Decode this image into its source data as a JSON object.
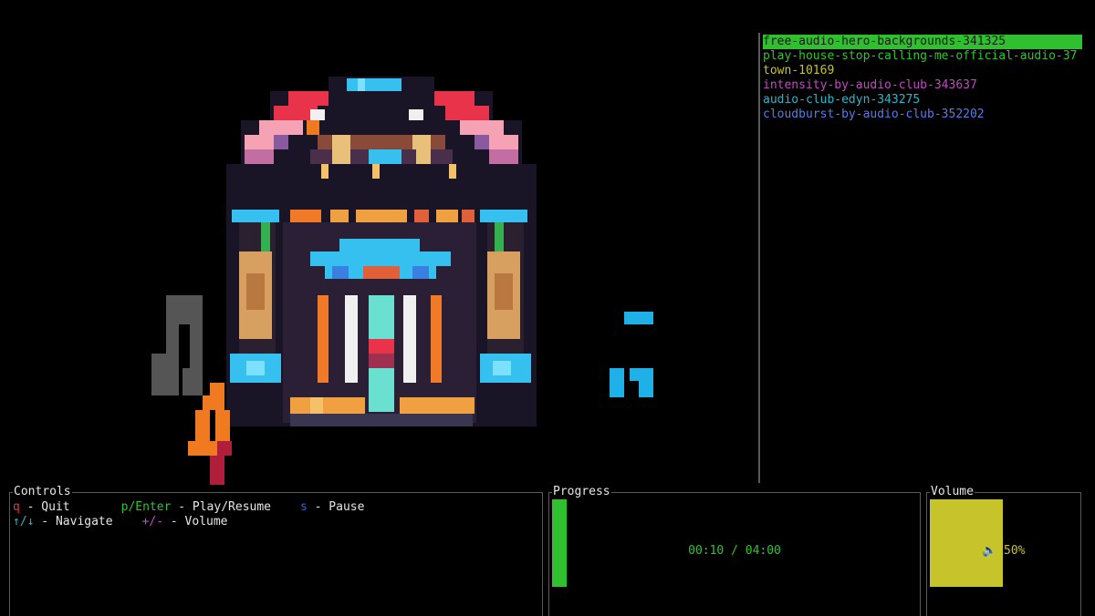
{
  "playlist": {
    "tracks": [
      {
        "label": "free-audio-hero-backgrounds-341325",
        "color": "#1a1a1a",
        "selected": true
      },
      {
        "label": "play-house-stop-calling-me-official-audio-37",
        "color": "#33c233"
      },
      {
        "label": "town-10169",
        "color": "#c7c42b"
      },
      {
        "label": "intensity-by-audio-club-343637",
        "color": "#c04bc0"
      },
      {
        "label": "audio-club-edyn-343275",
        "color": "#2fb6c9"
      },
      {
        "label": "cloudburst-by-audio-club-352202",
        "color": "#5b7be8"
      }
    ]
  },
  "controls": {
    "title": "Controls",
    "quit_key": "q",
    "quit_label": " - Quit",
    "play_key": "p/Enter",
    "play_label": " - Play/Resume",
    "pause_key": "s",
    "pause_label": " - Pause",
    "nav_key": "↑/↓",
    "nav_label": " - Navigate",
    "vol_key": "+/-",
    "vol_label": " - Volume"
  },
  "progress": {
    "title": "Progress",
    "fraction": 0.04,
    "time": "00:10 / 04:00"
  },
  "volume": {
    "title": "Volume",
    "percent": 50,
    "speaker_icon": "🔈",
    "text": "50%"
  },
  "visual": {
    "icon": "jukebox-icon",
    "note_icons": [
      "music-note-gray-icon",
      "music-note-orange-icon",
      "music-note-blue-icon"
    ]
  }
}
